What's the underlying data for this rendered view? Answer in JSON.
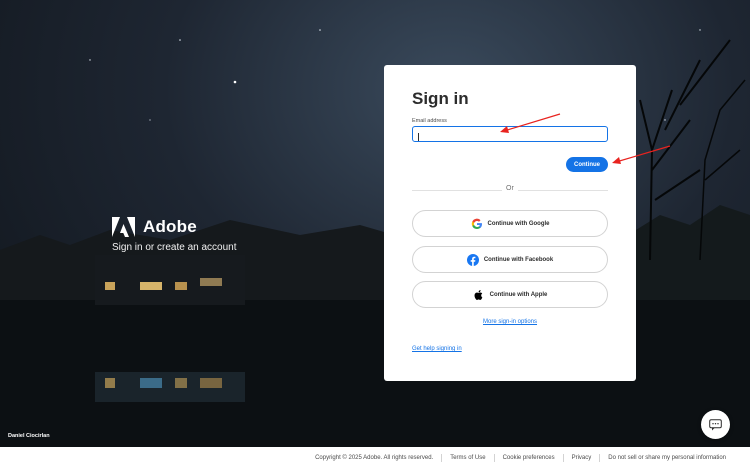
{
  "background": {
    "photo_credit": "Daniel Ciocirlan"
  },
  "brand": {
    "name": "Adobe",
    "tagline": "Sign in or create an account",
    "logo_icon": "adobe-logo-icon"
  },
  "signin": {
    "title": "Sign in",
    "email_label": "Email address",
    "email_value": "",
    "continue_label": "Continue",
    "divider_label": "Or",
    "google_label": "Continue with Google",
    "facebook_label": "Continue with Facebook",
    "apple_label": "Continue with Apple",
    "more_options_label": "More sign-in options",
    "help_label": "Get help signing in"
  },
  "colors": {
    "primary": "#1473e6",
    "annotation_arrow": "#e8231f"
  },
  "footer": {
    "copyright": "Copyright © 2025 Adobe. All rights reserved.",
    "terms": "Terms of Use",
    "cookie": "Cookie preferences",
    "privacy": "Privacy",
    "do_not_sell": "Do not sell or share my personal information"
  },
  "chat": {
    "icon": "chat-icon"
  }
}
